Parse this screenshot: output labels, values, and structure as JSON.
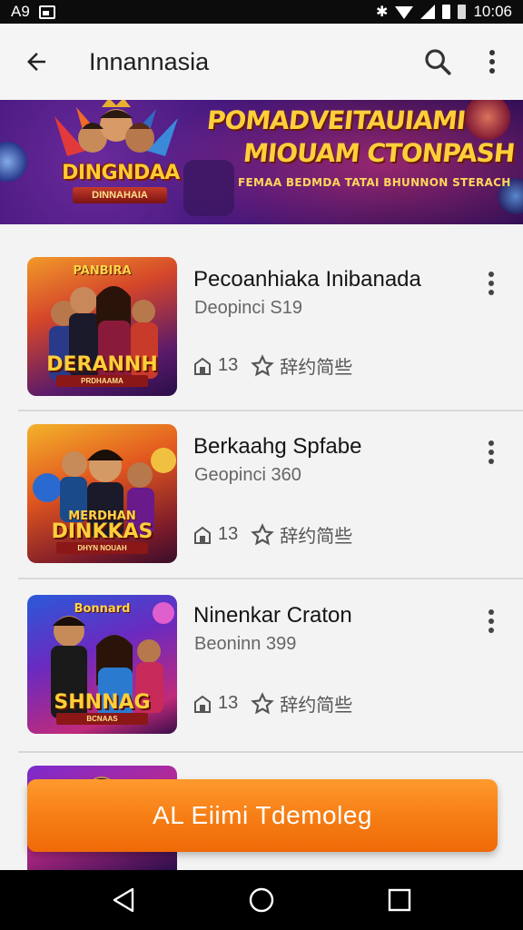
{
  "status_bar": {
    "left_text": "A9",
    "time": "10:06"
  },
  "app_bar": {
    "title": "Innannasia",
    "back_icon": "arrow-back-icon",
    "search_icon": "search-icon",
    "more_icon": "more-vert-icon"
  },
  "banner": {
    "logo_title": "DINGNDAA",
    "logo_subtitle": "DINNAHAIA",
    "headline_line1": "POMADVEITAUIAMI",
    "headline_line2": "MIOUAM CTONPASH",
    "headline_line3": "FEMAA BEDMDA TATAI BHUNNON STERACH"
  },
  "items": [
    {
      "title": "Pecoanhiaka Inibanada",
      "subtitle": "Deopinci S19",
      "count": "13",
      "meta_text": "辞约简些",
      "thumb_title": "DERANNH",
      "thumb_top": "PANBIRA",
      "thumb_ribbon": "PRDHAAMA"
    },
    {
      "title": "Berkaahg Spfabe",
      "subtitle": "Geopinci 360",
      "count": "13",
      "meta_text": "辞约简些",
      "thumb_title": "DINKKAS",
      "thumb_top": "MERDHAN",
      "thumb_ribbon": "DHYN NOUAH"
    },
    {
      "title": "Ninenkar Craton",
      "subtitle": "Beoninn 399",
      "count": "13",
      "meta_text": "辞约简些",
      "thumb_title": "SHNNAG",
      "thumb_top": "Bonnard",
      "thumb_ribbon": "BCNAAS"
    }
  ],
  "cta": {
    "label": "AL  Eiimi Tdemoleg"
  },
  "nav_bar": {
    "back_icon": "nav-back-icon",
    "home_icon": "nav-home-icon",
    "recents_icon": "nav-recents-icon"
  }
}
